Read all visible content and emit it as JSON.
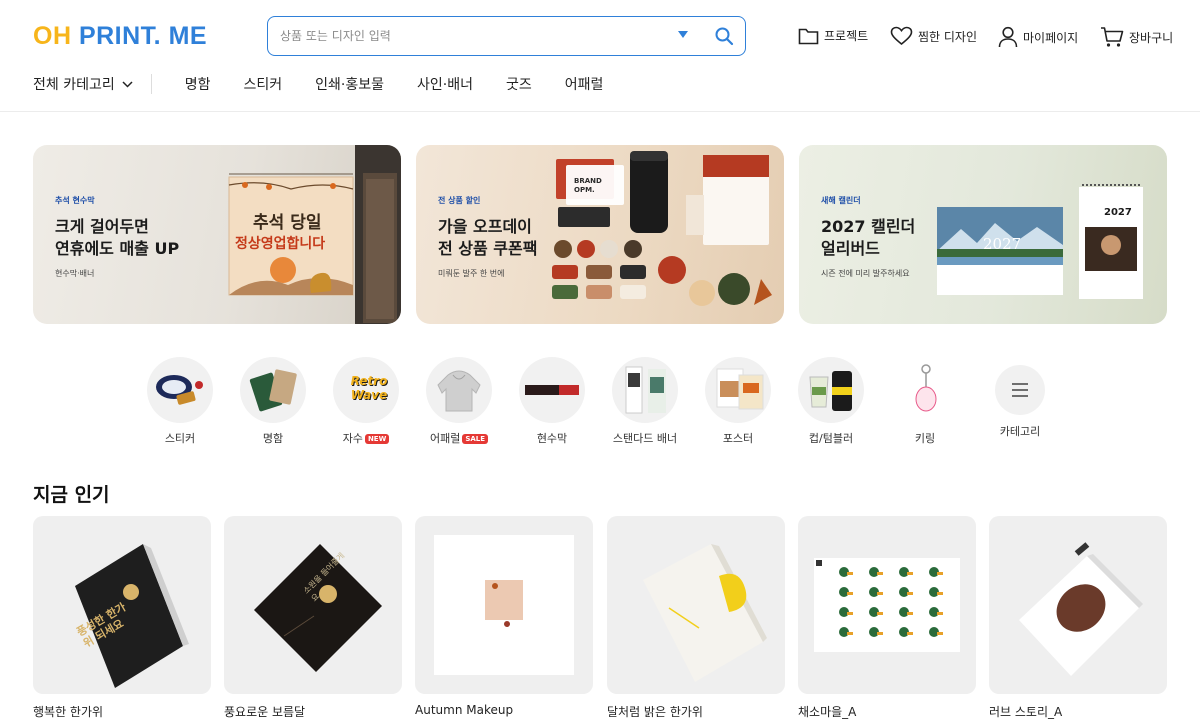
{
  "header": {
    "logo_oh": "OH",
    "logo_rest": "PRINT. ME",
    "search_placeholder": "상품 또는 디자인 입력",
    "nav": {
      "project": "프로젝트",
      "liked": "찜한 디자인",
      "mypage": "마이페이지",
      "cart": "장바구니"
    }
  },
  "catbar": {
    "all": "전체 카테고리",
    "items": [
      "명함",
      "스티커",
      "인쇄·홍보물",
      "사인·배너",
      "굿즈",
      "어패럴"
    ]
  },
  "banners": [
    {
      "tag": "추석 현수막",
      "title1": "크게 걸어두면",
      "title2": "연휴에도 매출 UP",
      "sub": "현수막·배너",
      "sign1": "추석 당일",
      "sign2": "정상영업합니다"
    },
    {
      "tag": "전 상품 할인",
      "title1": "가을 오프데이",
      "title2": "전 상품 쿠폰팩",
      "sub": "미뤄둔 발주 한 번에",
      "brand": "BRAND OPM."
    },
    {
      "tag": "새해 캘린더",
      "title1": "2027 캘린더",
      "title2": "얼리버드",
      "sub": "시즌 전에 미리 발주하세요",
      "cal_year": "2027"
    }
  ],
  "categories": [
    {
      "label": "스티커",
      "icon": "sticker-icon"
    },
    {
      "label": "명함",
      "icon": "business-card-icon"
    },
    {
      "label": "자수",
      "badge": "NEW",
      "badge_color": "#e53935",
      "icon": "embroidery-icon",
      "art": "Retro Wave"
    },
    {
      "label": "어패럴",
      "badge": "SALE",
      "badge_color": "#e53935",
      "icon": "hoodie-icon"
    },
    {
      "label": "현수막",
      "icon": "banner-icon"
    },
    {
      "label": "스탠다드 배너",
      "icon": "standard-banner-icon"
    },
    {
      "label": "포스터",
      "icon": "poster-icon"
    },
    {
      "label": "컵/텀블러",
      "icon": "cup-icon"
    },
    {
      "label": "키링",
      "icon": "keyring-icon"
    },
    {
      "label": "카테고리",
      "icon": "menu-icon"
    }
  ],
  "popular": {
    "title": "지금 인기",
    "items": [
      {
        "name": "행복한 한가위",
        "art": "풍성한 한가위 되세요"
      },
      {
        "name": "풍요로운 보름달",
        "art": "소원을 들어줄게요"
      },
      {
        "name": "Autumn Makeup"
      },
      {
        "name": "달처럼 밝은 한가위"
      },
      {
        "name": "채소마을_A"
      },
      {
        "name": "러브 스토리_A"
      }
    ]
  },
  "colors": {
    "brand_yellow": "#f7b51b",
    "brand_blue": "#2f80d9"
  }
}
